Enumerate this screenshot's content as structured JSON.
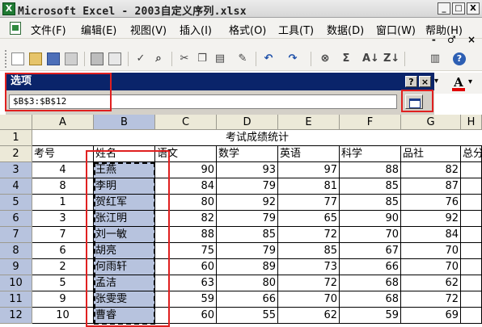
{
  "window": {
    "app_icon": "X",
    "title": "Microsoft Excel - 2003自定义序列.xlsx",
    "minimize": "_",
    "restore": "□",
    "close": "X"
  },
  "menu": {
    "items": [
      "文件(F)",
      "编辑(E)",
      "视图(V)",
      "插入(I)",
      "格式(O)",
      "工具(T)",
      "数据(D)",
      "窗口(W)",
      "帮助(H)"
    ],
    "mdi_minimize": "-",
    "mdi_restore": "♂",
    "mdi_close": "×"
  },
  "toolbar": {
    "icons": [
      "new-document-icon",
      "open-folder-icon",
      "save-icon",
      "permission-icon",
      "print-icon",
      "print-preview-icon",
      "spelling-icon",
      "research-icon",
      "cut-icon",
      "copy-icon",
      "paste-icon",
      "format-painter-icon",
      "undo-icon",
      "redo-icon",
      "hyperlink-icon",
      "autosum-icon",
      "sort-ascending-icon",
      "sort-descending-icon",
      "chart-icon",
      "help-icon"
    ],
    "glyphs": {
      "autosum": "Σ",
      "sort_asc": "A↓",
      "sort_desc": "Z↓",
      "undo": "↶",
      "redo": "↷",
      "help": "?"
    }
  },
  "dialog": {
    "title": "选项",
    "help": "?",
    "close": "×",
    "reference": "$B$3:$B$12"
  },
  "format_toolbar": {
    "font_color_glyph": "A",
    "dropdown": "▾"
  },
  "sheet": {
    "columns": [
      "A",
      "B",
      "C",
      "D",
      "E",
      "F",
      "G",
      "H"
    ],
    "selected_column": "B",
    "title": "考试成绩统计",
    "headers": [
      "考号",
      "姓名",
      "语文",
      "数学",
      "英语",
      "科学",
      "品社",
      "总分"
    ],
    "rows": [
      {
        "num": "3",
        "cells": [
          "4",
          "王燕",
          "90",
          "93",
          "97",
          "88",
          "82"
        ]
      },
      {
        "num": "4",
        "cells": [
          "8",
          "李明",
          "84",
          "79",
          "81",
          "85",
          "87"
        ]
      },
      {
        "num": "5",
        "cells": [
          "1",
          "贺红军",
          "80",
          "92",
          "77",
          "85",
          "76"
        ]
      },
      {
        "num": "6",
        "cells": [
          "3",
          "张江明",
          "82",
          "79",
          "65",
          "90",
          "92"
        ]
      },
      {
        "num": "7",
        "cells": [
          "7",
          "刘一敏",
          "88",
          "85",
          "72",
          "70",
          "84"
        ]
      },
      {
        "num": "8",
        "cells": [
          "6",
          "胡亮",
          "75",
          "79",
          "85",
          "67",
          "70"
        ]
      },
      {
        "num": "9",
        "cells": [
          "2",
          "何雨轩",
          "60",
          "89",
          "73",
          "66",
          "70"
        ]
      },
      {
        "num": "10",
        "cells": [
          "5",
          "孟洁",
          "63",
          "80",
          "72",
          "68",
          "62"
        ]
      },
      {
        "num": "11",
        "cells": [
          "9",
          "张雯雯",
          "59",
          "66",
          "70",
          "68",
          "72"
        ]
      },
      {
        "num": "12",
        "cells": [
          "10",
          "曹睿",
          "60",
          "55",
          "62",
          "59",
          "69"
        ]
      }
    ]
  },
  "colors": {
    "highlight": "#e02020",
    "dialog_title": "#0a246a",
    "selection": "#b7c3de"
  }
}
